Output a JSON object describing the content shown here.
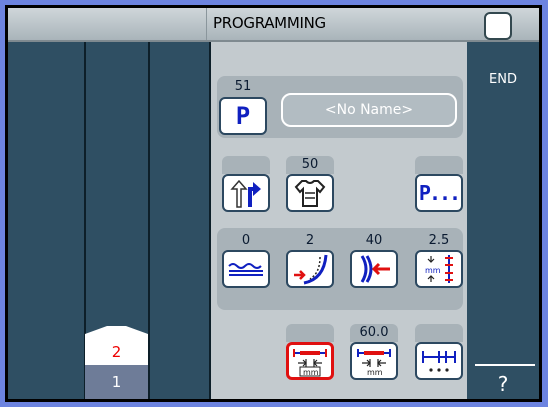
{
  "title": "PROGRAMMING",
  "top_right_button": "blank-square",
  "left_panel": {
    "stack_top_label": "2",
    "stack_bottom_label": "1"
  },
  "program": {
    "number_label": "51",
    "button_label": "P",
    "name_value": "<No Name>"
  },
  "row2": {
    "labels": [
      "",
      "50",
      ""
    ],
    "icons": [
      "direction-switch-icon",
      "garment-icon",
      "program-list-icon"
    ],
    "program_list_label": "P..."
  },
  "row3": {
    "labels": [
      "0",
      "2",
      "40",
      "2.5"
    ],
    "icons": [
      "wave-seam-icon",
      "curve-stitch-icon",
      "edge-guide-icon",
      "stitch-length-icon"
    ]
  },
  "row4": {
    "labels": [
      "",
      "60.0",
      ""
    ],
    "icons": [
      "seam-distance-mm-icon",
      "seam-offset-mm-icon",
      "seam-segments-icon"
    ],
    "mm_label": "mm"
  },
  "right_panel": {
    "end_label": "END",
    "help_label": "?"
  },
  "colors": {
    "background": "#2f4f63",
    "center_panel": "#c3cace",
    "accent_blue": "#1020c0",
    "accent_red": "#e01010"
  }
}
